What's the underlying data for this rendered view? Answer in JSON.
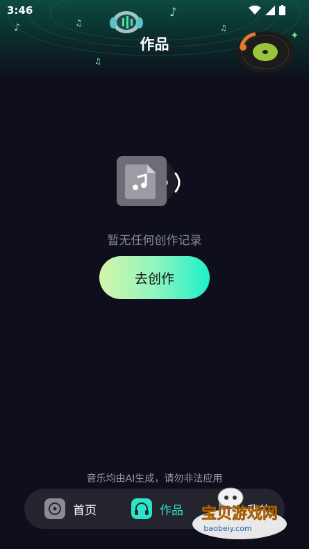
{
  "status_bar": {
    "time": "3:46"
  },
  "header": {
    "title": "作品"
  },
  "empty_state": {
    "message": "暂无任何创作记录",
    "button_label": "去创作"
  },
  "disclaimer": "音乐均由AI生成，请勿非法应用",
  "tabs": [
    {
      "label": "首页",
      "icon": "music-disc-icon",
      "active": false
    },
    {
      "label": "作品",
      "icon": "headphones-icon",
      "active": true
    },
    {
      "label": "我的",
      "icon": "profile-icon",
      "active": false
    }
  ],
  "watermark": {
    "brand": "宝贝游戏网",
    "url": "baobeiy.com"
  },
  "colors": {
    "background": "#0e0e1c",
    "accent": "#1ef0c8",
    "active_tab_text": "#29e6c8",
    "tab_bar": "#24242f"
  }
}
